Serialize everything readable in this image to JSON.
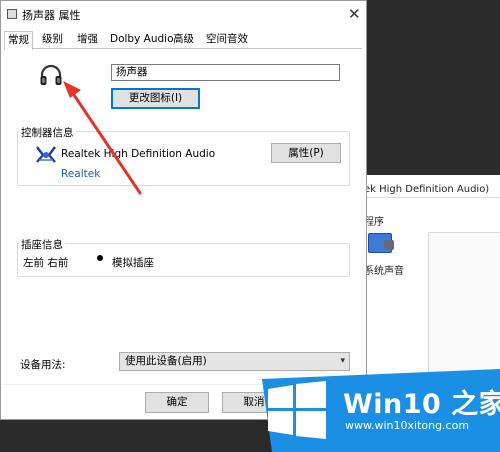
{
  "background_window": {
    "device_text": "ek High Definition Audio)",
    "section_text": "程序",
    "app_label": "系统声音"
  },
  "dialog": {
    "title": "扬声器 属性",
    "close_glyph": "✕",
    "tabs": [
      {
        "label": "常规",
        "active": true
      },
      {
        "label": "级别",
        "active": false
      },
      {
        "label": "增强",
        "active": false
      },
      {
        "label": "Dolby Audio",
        "active": false
      },
      {
        "label": "高级",
        "active": false
      },
      {
        "label": "空间音效",
        "active": false
      }
    ],
    "device_name_value": "扬声器",
    "change_icon_label": "更改图标(I)",
    "controller": {
      "group_label": "控制器信息",
      "name": "Realtek High Definition Audio",
      "vendor_link": "Realtek",
      "properties_label": "属性(P)"
    },
    "jack": {
      "group_label": "插座信息",
      "position": "左前 右前",
      "type": "模拟插座"
    },
    "usage": {
      "label": "设备用法:",
      "selected": "使用此设备(启用)"
    },
    "ok_label": "确定",
    "cancel_label": "取消"
  },
  "watermark": {
    "title": "Win10 之家",
    "url": "www.win10xitong.com"
  },
  "colors": {
    "annotation_arrow": "#e8332a",
    "logo_blue": "#1a8fe3",
    "link_blue": "#1a5fb4"
  }
}
